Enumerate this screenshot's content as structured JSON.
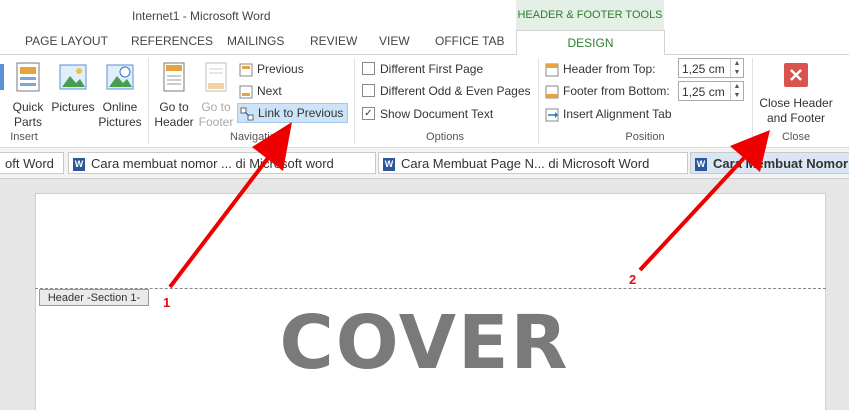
{
  "window": {
    "title": "Internet1 - Microsoft Word",
    "context_tab_group": "HEADER & FOOTER TOOLS"
  },
  "tabs": [
    "PAGE LAYOUT",
    "REFERENCES",
    "MAILINGS",
    "REVIEW",
    "VIEW",
    "OFFICE TAB"
  ],
  "active_tab": "DESIGN",
  "ribbon": {
    "insert": {
      "label": "Insert",
      "quick_parts": "Quick Parts",
      "pictures": "Pictures",
      "online_pictures": "Online Pictures"
    },
    "navigation": {
      "label": "Navigation",
      "go_to_header": "Go to Header",
      "go_to_footer": "Go to Footer",
      "previous": "Previous",
      "next": "Next",
      "link_to_previous": "Link to Previous"
    },
    "options": {
      "label": "Options",
      "different_first_page": "Different First Page",
      "different_odd_even": "Different Odd & Even Pages",
      "show_document_text": "Show Document Text",
      "show_document_text_checked": true
    },
    "position": {
      "label": "Position",
      "header_from_top": "Header from Top:",
      "header_from_top_value": "1,25 cm",
      "footer_from_bottom": "Footer from Bottom:",
      "footer_from_bottom_value": "1,25 cm",
      "insert_alignment_tab": "Insert Alignment Tab"
    },
    "close": {
      "label": "Close",
      "close_header_footer": "Close Header and Footer"
    }
  },
  "doc_tabs": [
    "oft Word",
    "Cara membuat nomor ... di Microsoft word",
    "Cara Membuat Page N... di Microsoft Word",
    "Cara Membuat Nomor"
  ],
  "document": {
    "header_tag": "Header -Section 1-",
    "cover_text": "COVER"
  },
  "annotations": {
    "marker1": "1",
    "marker2": "2"
  },
  "colors": {
    "accent_green": "#2e7d32",
    "annotation_red": "#dd1111",
    "close_red": "#d9534f"
  }
}
